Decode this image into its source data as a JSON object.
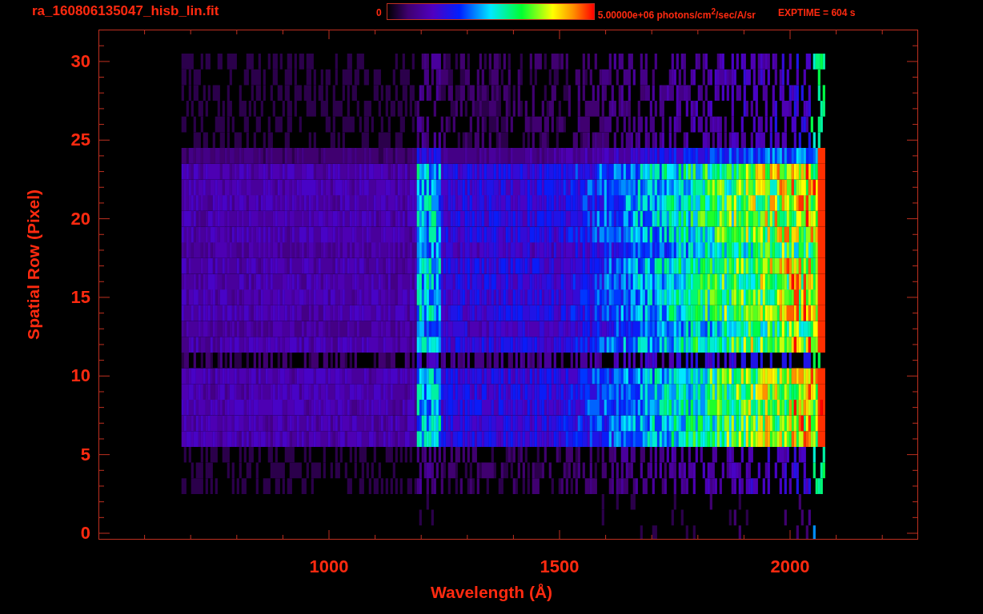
{
  "title": "ra_160806135047_hisb_lin.fit",
  "colorbar": {
    "min_label": "0",
    "max_label": "5.00000e+06 photons/cm$^{2}$/sec/A/sr"
  },
  "exposure": "EXPTIME = 604 s",
  "plot": {
    "ylabel": "Spatial Row (Pixel)",
    "xlabel": "Wavelength (Å)",
    "yticks": [
      "30",
      "25",
      "20",
      "15",
      "10",
      "5",
      "0"
    ],
    "xticks": [
      "1000",
      "1500",
      "2000"
    ]
  }
}
